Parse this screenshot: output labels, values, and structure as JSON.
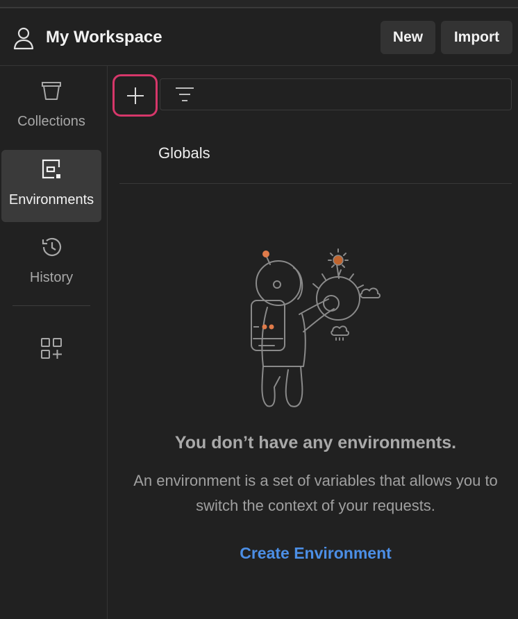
{
  "header": {
    "workspace_title": "My Workspace",
    "user_icon": "user-icon",
    "new_label": "New",
    "import_label": "Import"
  },
  "sidebar": {
    "items": [
      {
        "label": "Collections",
        "icon": "collections-icon",
        "active": false
      },
      {
        "label": "Environments",
        "icon": "environments-icon",
        "active": true
      },
      {
        "label": "History",
        "icon": "history-icon",
        "active": false
      }
    ],
    "apps_icon": "add-widget-icon"
  },
  "toolbar": {
    "add_icon": "plus-icon",
    "filter_icon": "filter-icon",
    "filter_placeholder": ""
  },
  "environments": {
    "globals_label": "Globals"
  },
  "empty_state": {
    "title": "You don’t have any environments.",
    "description": "An environment is a set of variables that allows you to switch the context of your requests.",
    "create_label": "Create Environment"
  },
  "colors": {
    "background": "#212121",
    "accent_link": "#4c8fe6",
    "highlight_border": "#d6376a",
    "active_item_bg": "#3a3a3a",
    "illustration_accent": "#e07b4a"
  }
}
